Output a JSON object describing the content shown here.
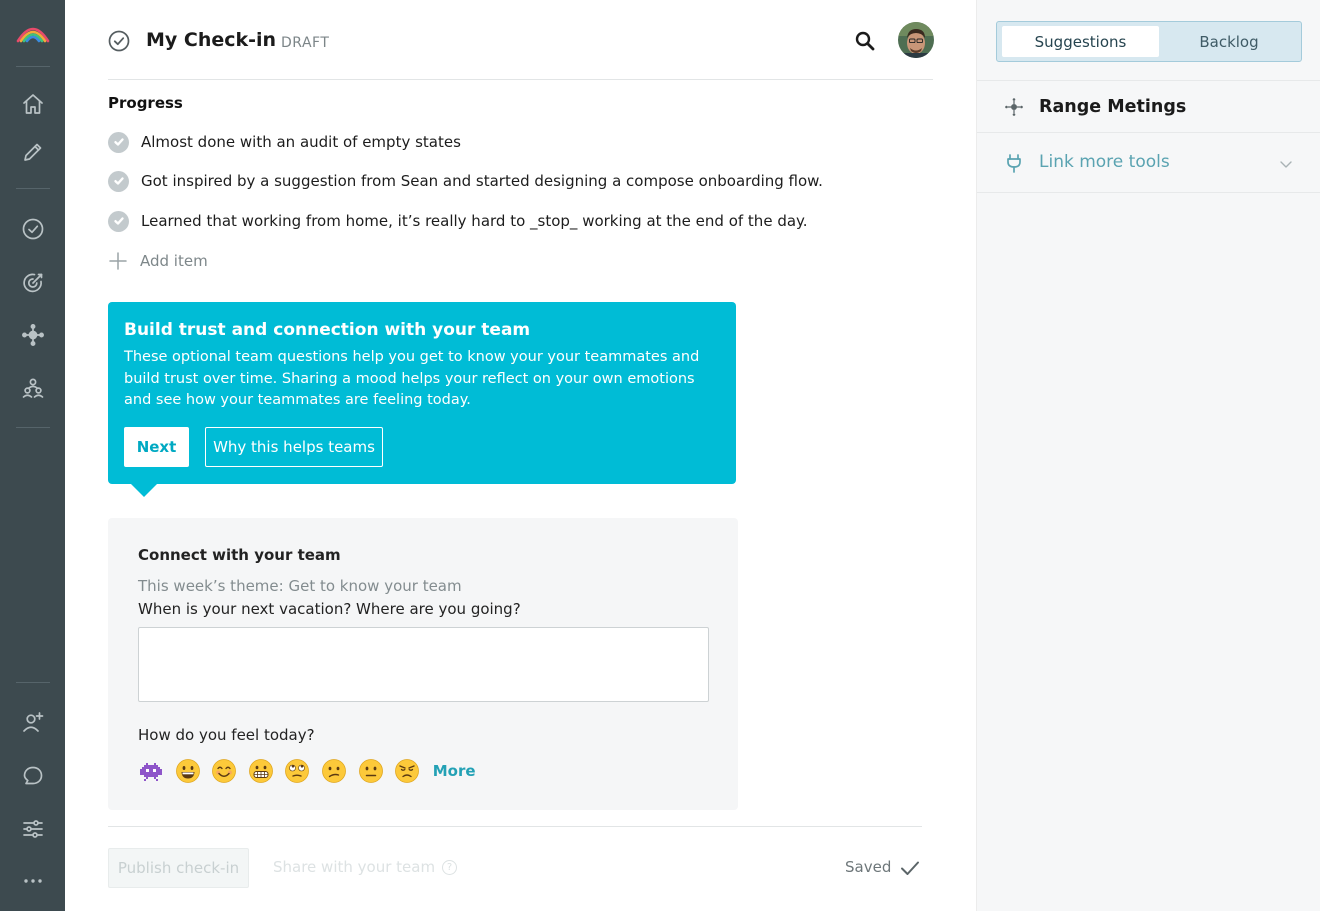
{
  "header": {
    "title": "My Check-in",
    "status": "DRAFT"
  },
  "progress": {
    "label": "Progress",
    "items": [
      "Almost done with an audit of empty states",
      "Got inspired by a suggestion from Sean and started designing a compose onboarding flow.",
      "Learned that working from home, it’s really hard to _stop_ working at the end of the day."
    ],
    "add_label": "Add item"
  },
  "tip": {
    "title": "Build trust and connection with your team",
    "body": "These optional team questions help you get to know your your teammates and build trust over time. Sharing a mood helps your reflect on your own emotions and see how your teammates are feeling today.",
    "next_label": "Next",
    "why_label": "Why this helps teams"
  },
  "connect": {
    "title": "Connect with your team",
    "theme": "This week’s theme: Get to know your team",
    "question": "When is your next vacation? Where are you going?",
    "answer_value": "",
    "mood_question": "How do you feel today?",
    "moods": [
      "space-invader",
      "grinning",
      "smiling",
      "grimacing",
      "eye-roll",
      "confused",
      "neutral",
      "angry"
    ],
    "more_label": "More"
  },
  "footer": {
    "publish_label": "Publish check-in",
    "share_label": "Share with your team",
    "share_help": "?",
    "saved_label": "Saved"
  },
  "side": {
    "tabs": [
      "Suggestions",
      "Backlog"
    ],
    "active_tab": "Suggestions",
    "meetings_label": "Range Metings",
    "link_tools_label": "Link more tools"
  },
  "colors": {
    "nav_bg": "#3d4a4f",
    "accent": "#00bcd6",
    "link": "#5aa3b1"
  },
  "nav_icons": [
    "rainbow-logo-icon",
    "home-icon",
    "pencil-icon",
    "check-circle-icon",
    "target-icon",
    "hub-icon",
    "people-icon",
    "add-person-icon",
    "chat-icon",
    "sliders-icon",
    "more-icon"
  ]
}
